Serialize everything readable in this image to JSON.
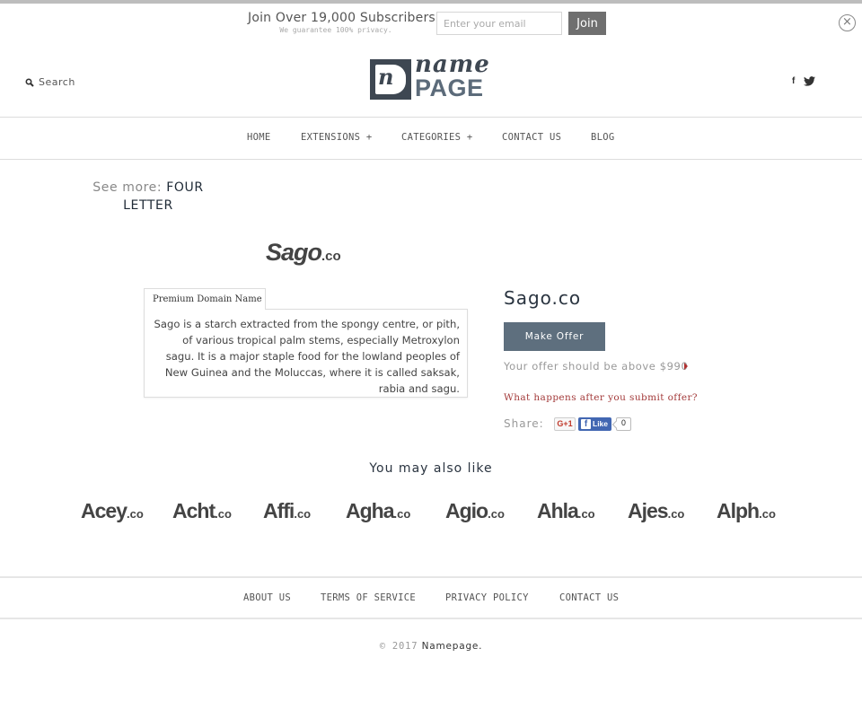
{
  "subscribe": {
    "title": "Join Over 19,000 Subscribers",
    "note": "We guarantee 100% privacy.",
    "email_placeholder": "Enter your email",
    "email_value": "",
    "join_label": "Join",
    "close_icon": "circle-x-icon"
  },
  "header": {
    "search_label": "Search",
    "search_icon": "magnifier-icon",
    "logo": {
      "mark": "n",
      "word_top": "name",
      "word_bottom": "PAGE"
    },
    "social": [
      {
        "name": "facebook",
        "glyph": "f"
      },
      {
        "name": "twitter",
        "glyph": "bird"
      }
    ]
  },
  "nav": {
    "items": [
      {
        "label": "HOME"
      },
      {
        "label": "EXTENSIONS +"
      },
      {
        "label": "CATEGORIES +"
      },
      {
        "label": "CONTACT US"
      },
      {
        "label": "BLOG"
      }
    ]
  },
  "see_more": {
    "label": "See more:",
    "link": "FOUR LETTER"
  },
  "product": {
    "logo_main": "Sago",
    "logo_tld": ".co",
    "tab_label": "Premium Domain Name",
    "description": "Sago is a starch extracted from the spongy centre, or pith, of various tropical palm stems, especially Metroxylon sagu. It is a major staple food for the lowland peoples of New Guinea and the Moluccas, where it is called saksak, rabia and sagu.",
    "title": "Sago.co",
    "offer_button": "Make Offer",
    "offer_hint": "Your offer should be above $990",
    "what_happens_link": "What happens after you submit offer?",
    "share_label": "Share:",
    "gplus_label": "G+1",
    "fb_like_label": "Like",
    "fb_like_count": "0"
  },
  "also_like": {
    "title": "You may also like",
    "items": [
      {
        "main": "Acey",
        "tld": ".co"
      },
      {
        "main": "Acht",
        "tld": ".co"
      },
      {
        "main": "Affi",
        "tld": ".co"
      },
      {
        "main": "Agha",
        "tld": ".co"
      },
      {
        "main": "Agio",
        "tld": ".co"
      },
      {
        "main": "Ahla",
        "tld": ".co"
      },
      {
        "main": "Ajes",
        "tld": ".co"
      },
      {
        "main": "Alph",
        "tld": ".co"
      }
    ]
  },
  "footer": {
    "links": [
      {
        "label": "ABOUT US"
      },
      {
        "label": "TERMS OF SERVICE"
      },
      {
        "label": "PRIVACY POLICY"
      },
      {
        "label": "CONTACT US"
      }
    ],
    "copyright_prefix": "© 2017",
    "copyright_brand": "Namepage."
  },
  "colors": {
    "accent_button": "#5e6f7e",
    "join_button": "#6f6f6f",
    "link_red": "#a33a3a",
    "facebook_blue": "#4267b2",
    "heading_dark": "#2a3440"
  }
}
